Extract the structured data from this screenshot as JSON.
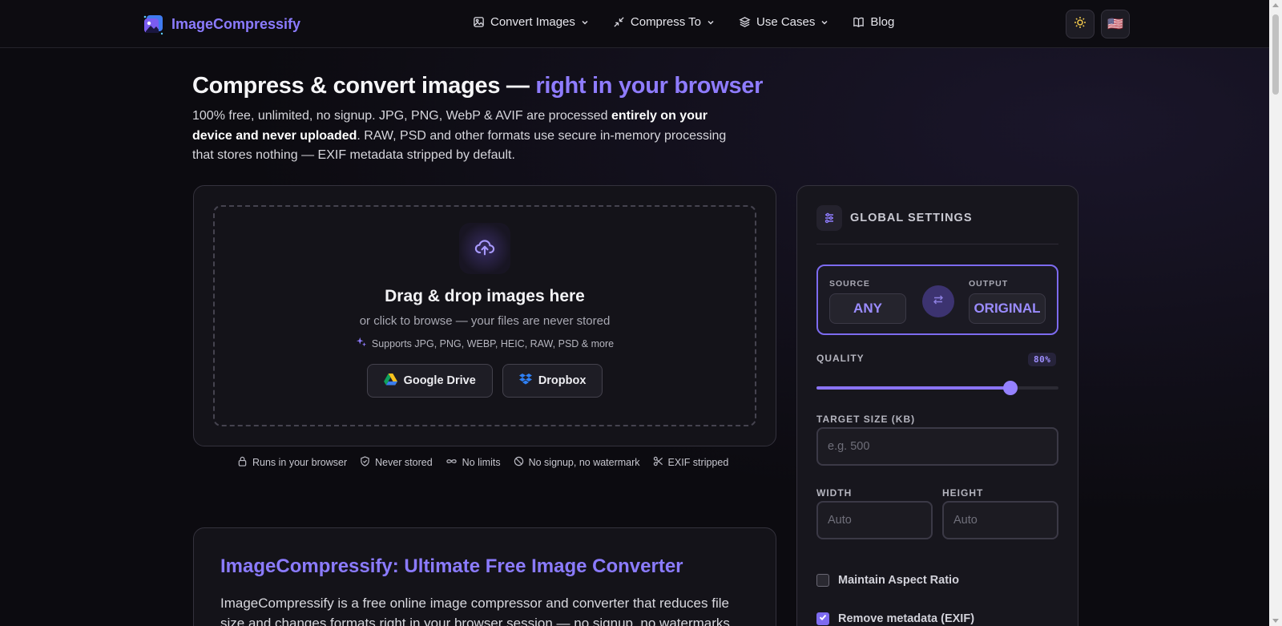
{
  "header": {
    "brand": "ImageCompressify",
    "nav": [
      {
        "label": "Convert Images",
        "icon": "image-icon",
        "dropdown": true
      },
      {
        "label": "Compress To",
        "icon": "minimize-icon",
        "dropdown": true
      },
      {
        "label": "Use Cases",
        "icon": "layers-icon",
        "dropdown": true
      },
      {
        "label": "Blog",
        "icon": "book-icon",
        "dropdown": false
      }
    ],
    "theme_icon": "sun-icon",
    "language_flag": "🇺🇸"
  },
  "hero": {
    "title_main": "Compress & convert images — ",
    "title_accent": "right in your browser",
    "desc_part1": "100% free, unlimited, no signup. JPG, PNG, WebP & AVIF are processed ",
    "desc_bold": "entirely on your device and never uploaded",
    "desc_part2": ". RAW, PSD and other formats use secure in-memory processing that stores nothing — EXIF metadata stripped by default."
  },
  "upload": {
    "title": "Drag & drop images here",
    "subtitle": "or click to browse — your files are never stored",
    "formats": "Supports JPG, PNG, WEBP, HEIC, RAW, PSD & more",
    "google_drive": "Google Drive",
    "dropbox": "Dropbox"
  },
  "trust": [
    {
      "label": "Runs in your browser",
      "icon": "lock-icon"
    },
    {
      "label": "Never stored",
      "icon": "shield-check-icon"
    },
    {
      "label": "No limits",
      "icon": "infinity-icon"
    },
    {
      "label": "No signup, no watermark",
      "icon": "ban-icon"
    },
    {
      "label": "EXIF stripped",
      "icon": "scissors-icon"
    }
  ],
  "article": {
    "title": "ImageCompressify: Ultimate Free Image Converter",
    "body": "ImageCompressify is a free online image compressor and converter that reduces file size and changes formats right in your browser session — no signup, no watermarks"
  },
  "settings": {
    "title": "GLOBAL SETTINGS",
    "source_label": "SOURCE",
    "source_value": "ANY",
    "output_label": "OUTPUT",
    "output_value": "ORIGINAL",
    "quality_label": "QUALITY",
    "quality_value": "80%",
    "quality_fraction": 0.8,
    "target_label": "TARGET SIZE (KB)",
    "target_placeholder": "e.g. 500",
    "width_label": "WIDTH",
    "width_placeholder": "Auto",
    "height_label": "HEIGHT",
    "height_placeholder": "Auto",
    "aspect_label": "Maintain Aspect Ratio",
    "aspect_checked": false,
    "metadata_label": "Remove metadata (EXIF)",
    "metadata_checked": true
  },
  "colors": {
    "accent": "#8b7bff",
    "background": "#0c0b10",
    "card": "#141319"
  }
}
